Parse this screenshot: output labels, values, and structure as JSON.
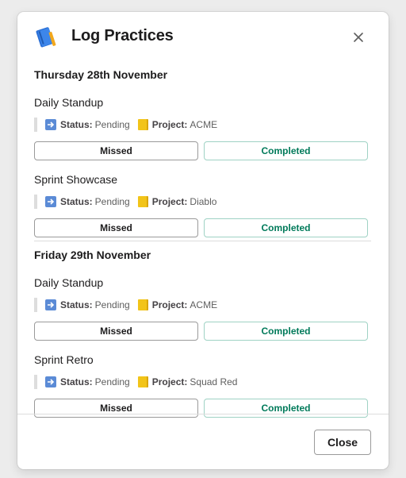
{
  "modal": {
    "title": "Log Practices",
    "close_icon": "close-x-icon",
    "title_icon": "blue-notebook-icon"
  },
  "days": [
    {
      "heading": "Thursday 28th November",
      "practices": [
        {
          "name": "Daily Standup",
          "status_label": "Status:",
          "status": "Pending",
          "project_label": "Project:",
          "project": "ACME",
          "missed_label": "Missed",
          "completed_label": "Completed"
        },
        {
          "name": "Sprint Showcase",
          "status_label": "Status:",
          "status": "Pending",
          "project_label": "Project:",
          "project": "Diablo",
          "missed_label": "Missed",
          "completed_label": "Completed"
        }
      ]
    },
    {
      "heading": "Friday 29th November",
      "practices": [
        {
          "name": "Daily Standup",
          "status_label": "Status:",
          "status": "Pending",
          "project_label": "Project:",
          "project": "ACME",
          "missed_label": "Missed",
          "completed_label": "Completed"
        },
        {
          "name": "Sprint Retro",
          "status_label": "Status:",
          "status": "Pending",
          "project_label": "Project:",
          "project": "Squad Red",
          "missed_label": "Missed",
          "completed_label": "Completed"
        }
      ]
    }
  ],
  "footer": {
    "close_label": "Close"
  },
  "colors": {
    "completed_text": "#007a5a",
    "completed_border": "#9fd2c4",
    "arrow_emoji": "#5b8bd6",
    "folder_emoji": "#f2c419"
  }
}
